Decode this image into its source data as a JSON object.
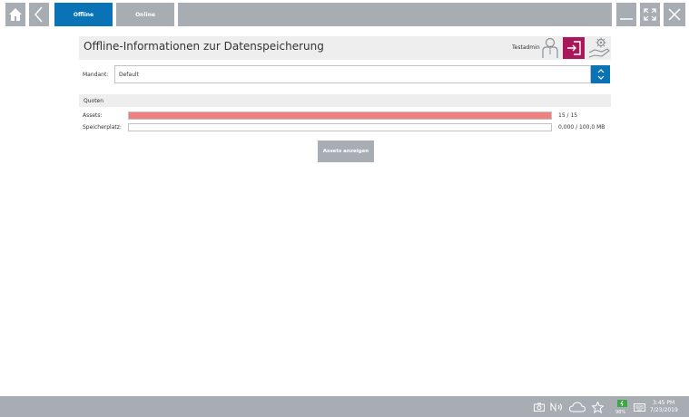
{
  "toolbar": {
    "home_icon": "home-icon",
    "back_icon": "chevron-left-icon",
    "tabs": [
      {
        "label": "Offline",
        "active": true
      },
      {
        "label": "Online",
        "active": false
      }
    ],
    "minimize_icon": "minimize-icon",
    "fullscreen_icon": "fullscreen-icon",
    "close_icon": "close-icon"
  },
  "header": {
    "title": "Offline-Informationen zur Datenspeicherung",
    "user_name": "Testadmin"
  },
  "mandant": {
    "label": "Mandant:",
    "value": "Default"
  },
  "quoten": {
    "title": "Quoten",
    "rows": [
      {
        "label": "Assets:",
        "value": "15 / 15",
        "fill": 1.0,
        "color": "#f08080"
      },
      {
        "label": "Speicherplatz:",
        "value": "0,000 / 100,0 MB",
        "fill": 0.0,
        "color": "#f08080"
      }
    ]
  },
  "actions": {
    "show_assets_label": "Assets anzeigen"
  },
  "taskbar": {
    "battery": "98%",
    "time": "3:45 PM",
    "date": "7/23/2019"
  },
  "colors": {
    "accent": "#0a73b5",
    "logout": "#a8185a",
    "bar_fill": "#f08080",
    "gray": "#a8acb3"
  }
}
